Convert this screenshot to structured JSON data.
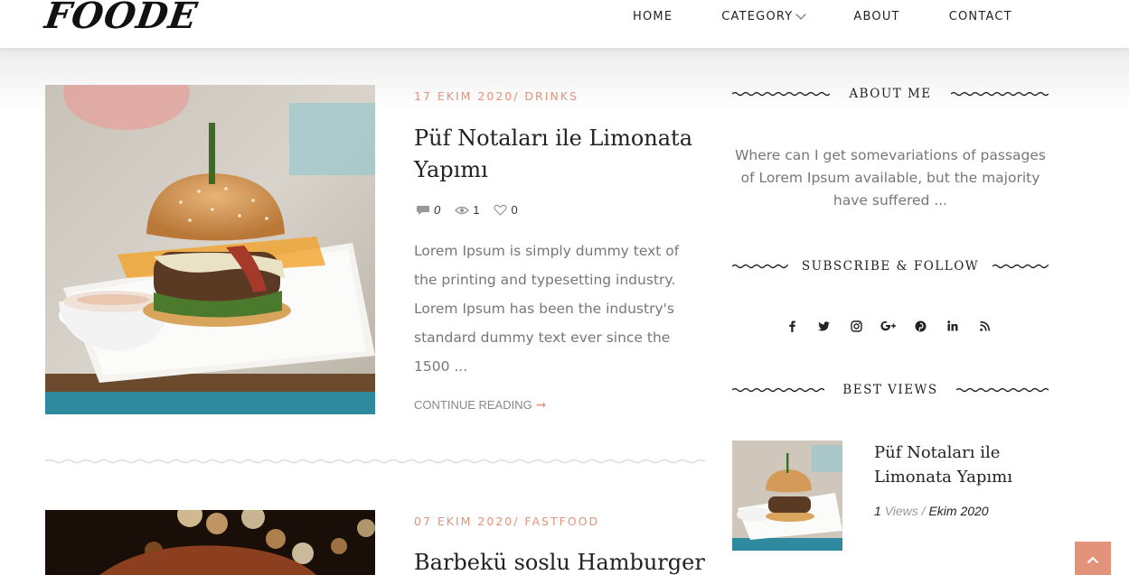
{
  "header": {
    "logo": "FOODE",
    "nav": [
      {
        "label": "HOME"
      },
      {
        "label": "CATEGORY",
        "has_dropdown": true
      },
      {
        "label": "ABOUT"
      },
      {
        "label": "CONTACT"
      }
    ]
  },
  "posts": [
    {
      "meta": "17 EKIM 2020/ DRINKS",
      "title": "Püf Notaları ile Limonata Yapımı",
      "comments": "0",
      "views": "1",
      "likes": "0",
      "excerpt": "Lorem Ipsum is simply dummy text of the printing and typesetting industry. Lorem Ipsum has been the industry's standard dummy text ever since the 1500 ...",
      "continue_label": "CONTINUE READING"
    },
    {
      "meta": "07 EKIM 2020/ FASTFOOD",
      "title": "Barbekü soslu Hamburger"
    }
  ],
  "sidebar": {
    "about": {
      "heading": "ABOUT ME",
      "text": "Where can I get somevariations of passages of Lorem Ipsum available, but the majority have suffered ..."
    },
    "subscribe": {
      "heading": "SUBSCRIBE & FOLLOW",
      "icons": [
        "facebook-icon",
        "twitter-icon",
        "instagram-icon",
        "google-plus-icon",
        "pinterest-icon",
        "linkedin-icon",
        "rss-icon"
      ]
    },
    "best_views": {
      "heading": "BEST VIEWS",
      "items": [
        {
          "title": "Püf Notaları ile Limonata Yapımı",
          "views_count": "1",
          "views_label": "Views",
          "separator": "/",
          "date": "Ekim 2020"
        }
      ]
    }
  },
  "colors": {
    "accent": "#e2937a",
    "text": "#222222",
    "muted": "#777777"
  }
}
